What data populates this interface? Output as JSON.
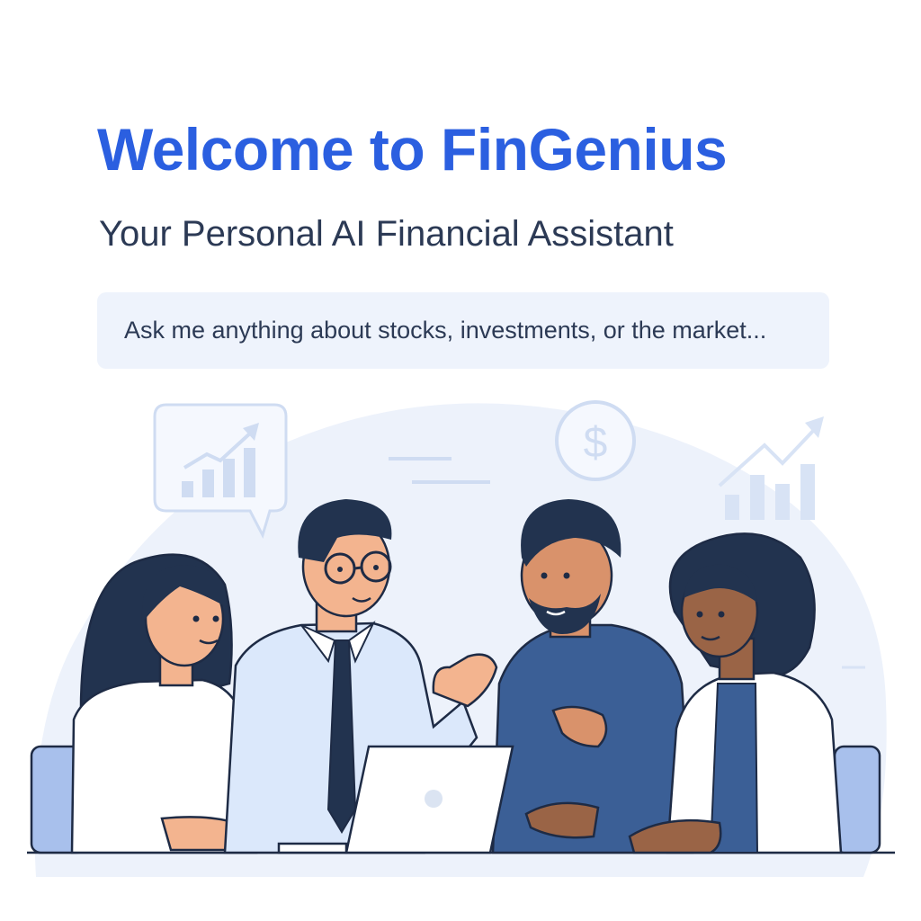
{
  "header": {
    "title": "Welcome to FinGenius",
    "subtitle": "Your Personal AI Financial Assistant"
  },
  "search": {
    "placeholder": "Ask me anything about stocks, investments, or the market..."
  },
  "illustration": {
    "icons": [
      "chart-bubble-icon",
      "dollar-coin-icon",
      "trend-chart-icon",
      "laptop-icon"
    ]
  },
  "colors": {
    "accent": "#2b5fe0",
    "text": "#2c3a55",
    "input_bg": "#eef3fc",
    "illustration_bg": "#edf2fb",
    "outline": "#1e2b45"
  }
}
